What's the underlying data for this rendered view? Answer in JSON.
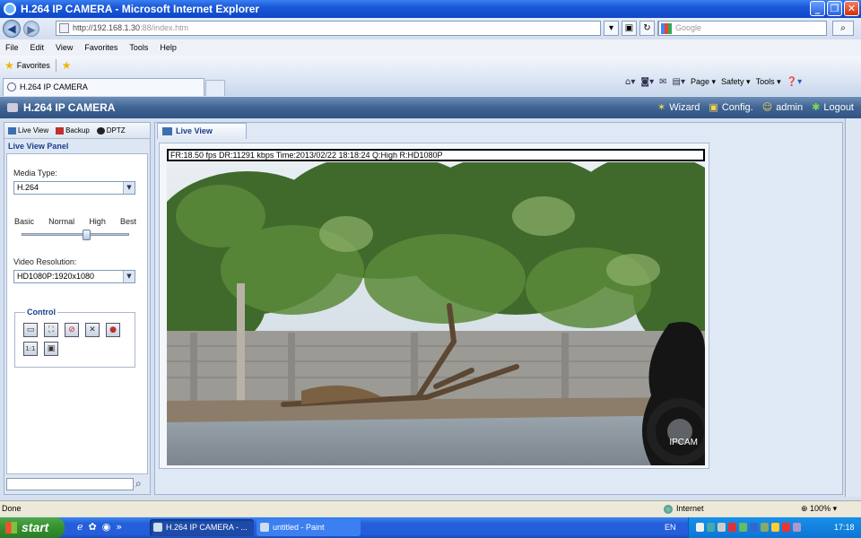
{
  "window": {
    "title": "H.264 IP CAMERA - Microsoft Internet Explorer",
    "controls": [
      "_",
      "❐",
      "✕"
    ]
  },
  "address": {
    "url_host": "http://192.168.1.30",
    "url_rest": ":88/index.htm",
    "search_placeholder": "Google"
  },
  "menu": [
    "File",
    "Edit",
    "View",
    "Favorites",
    "Tools",
    "Help"
  ],
  "favorites": {
    "label": "Favorites"
  },
  "tab": {
    "label": "H.264 IP CAMERA"
  },
  "commandbar": [
    "Page",
    "Safety",
    "Tools"
  ],
  "app": {
    "logo": "H.264 IP CAMERA",
    "links": [
      {
        "label": "Wizard",
        "icon": "wizard-icon"
      },
      {
        "label": "Config.",
        "icon": "config-icon"
      },
      {
        "label": "admin",
        "icon": "user-icon"
      },
      {
        "label": "Logout",
        "icon": "logout-icon"
      }
    ]
  },
  "sidebar": {
    "tabs": [
      "Live View",
      "Backup",
      "DPTZ"
    ],
    "panel_title": "Live View Panel",
    "media_type_label": "Media Type:",
    "media_type_value": "H.264",
    "quality_labels": [
      "Basic",
      "Normal",
      "High",
      "Best"
    ],
    "quality_level_index": 2,
    "resolution_label": "Video Resolution:",
    "resolution_value": "HD1080P:1920x1080",
    "control_title": "Control",
    "controls": [
      "snapshot-icon",
      "fullscreen-icon",
      "mute-icon",
      "zoom-icon",
      "record-icon",
      "ratio-icon",
      "save-icon"
    ]
  },
  "main": {
    "tab_label": "Live View",
    "osd": "FR:18.50 fps  DR:11291 kbps Time:2013/02/22 18:18:24 Q:High R:HD1080P",
    "watermark": "IPCAM"
  },
  "status": {
    "left": "Done",
    "zone": "Internet",
    "zoom": "100%"
  },
  "taskbar": {
    "start": "start",
    "tasks": [
      {
        "label": "H.264 IP CAMERA - ...",
        "active": true
      },
      {
        "label": "untitled - Paint",
        "active": false
      }
    ],
    "language": "EN",
    "clock": "17:18"
  }
}
